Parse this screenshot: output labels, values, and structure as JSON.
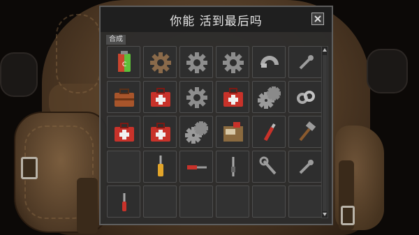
{
  "window": {
    "title": "你能 活到最后吗"
  },
  "tabs": [
    {
      "label": "合成"
    }
  ],
  "inventory": {
    "rows": [
      [
        {
          "item": "green-battery-icon"
        },
        {
          "item": "rusty-gear-icon"
        },
        {
          "item": "gear-icon"
        },
        {
          "item": "gear-icon"
        },
        {
          "item": "metal-clamp-icon"
        },
        {
          "item": "small-wrench-icon"
        }
      ],
      [
        {
          "item": "brown-toolbox-icon"
        },
        {
          "item": "first-aid-kit-icon"
        },
        {
          "item": "gear-icon"
        },
        {
          "item": "first-aid-kit-icon"
        },
        {
          "item": "double-gear-icon"
        },
        {
          "item": "chain-link-icon"
        }
      ],
      [
        {
          "item": "first-aid-kit-icon"
        },
        {
          "item": "first-aid-kit-icon"
        },
        {
          "item": "double-gear-icon"
        },
        {
          "item": "wooden-crate-icon"
        },
        {
          "item": "red-handle-wrench-icon"
        },
        {
          "item": "hammer-icon"
        }
      ],
      [
        {
          "item": "empty"
        },
        {
          "item": "screwdriver-icon"
        },
        {
          "item": "drill-bit-icon"
        },
        {
          "item": "spark-plug-icon"
        },
        {
          "item": "open-wrench-icon"
        },
        {
          "item": "small-wrench-icon"
        }
      ],
      [
        {
          "item": "small-screwdriver-icon"
        },
        {
          "item": "empty"
        },
        {
          "item": "empty"
        },
        {
          "item": "empty"
        },
        {
          "item": "empty"
        },
        {
          "item": "empty"
        }
      ]
    ]
  },
  "colors": {
    "panel_bg": "#2c2c2c",
    "cell_bg": "#2e2e2e",
    "red_kit": "#c8322a",
    "gear": "#8d8d8d",
    "green_battery": "#5fbf3a"
  }
}
